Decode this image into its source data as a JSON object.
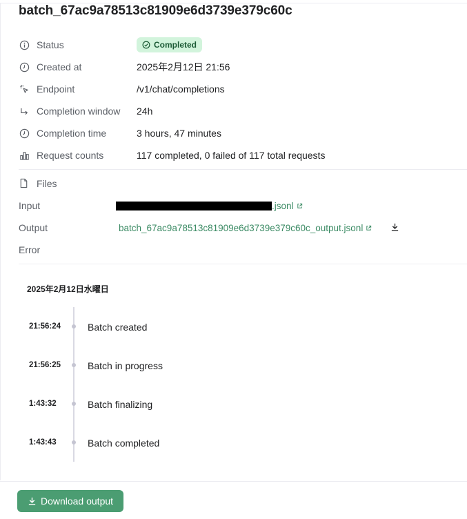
{
  "title": "batch_67ac9a78513c81909e6d3739e379c60c",
  "details": {
    "status": {
      "label": "Status",
      "badge": "Completed",
      "icon": "info-icon"
    },
    "created_at": {
      "label": "Created at",
      "value": "2025年2月12日 21:56",
      "icon": "clock-icon"
    },
    "endpoint": {
      "label": "Endpoint",
      "value": "/v1/chat/completions",
      "icon": "pointer-click-icon"
    },
    "completion_window": {
      "label": "Completion window",
      "value": "24h",
      "icon": "arrow-turn-right-icon"
    },
    "completion_time": {
      "label": "Completion time",
      "value": "3 hours, 47 minutes",
      "icon": "clock-icon"
    },
    "request_counts": {
      "label": "Request counts",
      "value": "117 completed, 0 failed of 117 total requests",
      "icon": "bar-chart-icon"
    }
  },
  "files": {
    "label": "Files",
    "input_label": "Input",
    "input_value_suffix": ".jsonl",
    "output_label": "Output",
    "output_value": "batch_67ac9a78513c81909e6d3739e379c60c_output.jsonl",
    "error_label": "Error"
  },
  "timeline": {
    "date": "2025年2月12日水曜日",
    "events": [
      {
        "time": "21:56:24",
        "event": "Batch created"
      },
      {
        "time": "21:56:25",
        "event": "Batch in progress"
      },
      {
        "time": "1:43:32",
        "event": "Batch finalizing"
      },
      {
        "time": "1:43:43",
        "event": "Batch completed"
      }
    ]
  },
  "download_button": {
    "label": "Download output"
  },
  "colors": {
    "accent": "#4b9d72",
    "link": "#3a8a63",
    "badge_bg": "#d2f4dc",
    "badge_text": "#1b5a35"
  }
}
